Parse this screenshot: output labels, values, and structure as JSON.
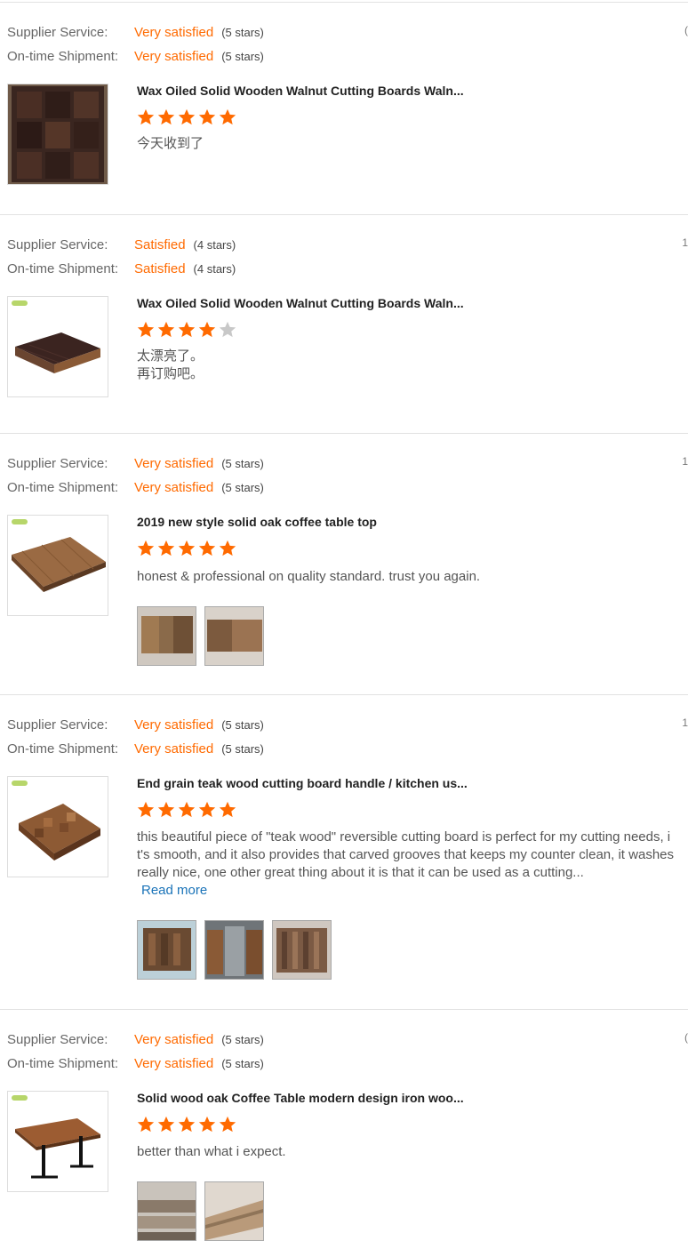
{
  "labels": {
    "supplier": "Supplier Service:",
    "shipment": "On-time Shipment:"
  },
  "reviews": [
    {
      "supplier": "Very satisfied",
      "supplier_stars": "(5 stars)",
      "shipment": "Very satisfied",
      "shipment_stars": "(5 stars)",
      "edge": "(",
      "title": "Wax Oiled Solid Wooden Walnut Cutting Boards Waln...",
      "rating": 5,
      "text": "今天收到了"
    },
    {
      "supplier": "Satisfied",
      "supplier_stars": "(4 stars)",
      "shipment": "Satisfied",
      "shipment_stars": "(4 stars)",
      "edge": "1",
      "title": "Wax Oiled Solid Wooden Walnut Cutting Boards Waln...",
      "rating": 4,
      "text": "太漂亮了。\n再订购吧。"
    },
    {
      "supplier": "Very satisfied",
      "supplier_stars": "(5 stars)",
      "shipment": "Very satisfied",
      "shipment_stars": "(5 stars)",
      "edge": "1",
      "title": "2019 new style solid oak coffee table top",
      "rating": 5,
      "text": "honest & professional on quality standard. trust you again."
    },
    {
      "supplier": "Very satisfied",
      "supplier_stars": "(5 stars)",
      "shipment": "Very satisfied",
      "shipment_stars": "(5 stars)",
      "edge": "1",
      "title": "End grain teak wood cutting board handle / kitchen us...",
      "rating": 5,
      "text": "this beautiful piece of \"teak wood\" reversible cutting board is perfect for my cutting needs, i\nt's smooth, and it also provides that carved grooves that keeps my counter clean, it washes\nreally nice, one other great thing about it is that it can be used as a cutting...",
      "read_more": "Read more"
    },
    {
      "supplier": "Very satisfied",
      "supplier_stars": "(5 stars)",
      "shipment": "Very satisfied",
      "shipment_stars": "(5 stars)",
      "edge": "(",
      "title": "Solid wood oak Coffee Table modern design iron woo...",
      "rating": 5,
      "text": "better than what i expect."
    }
  ],
  "colors": {
    "accent": "#ff6a00",
    "star_empty": "#c8c8c8",
    "link": "#1a73b8"
  }
}
